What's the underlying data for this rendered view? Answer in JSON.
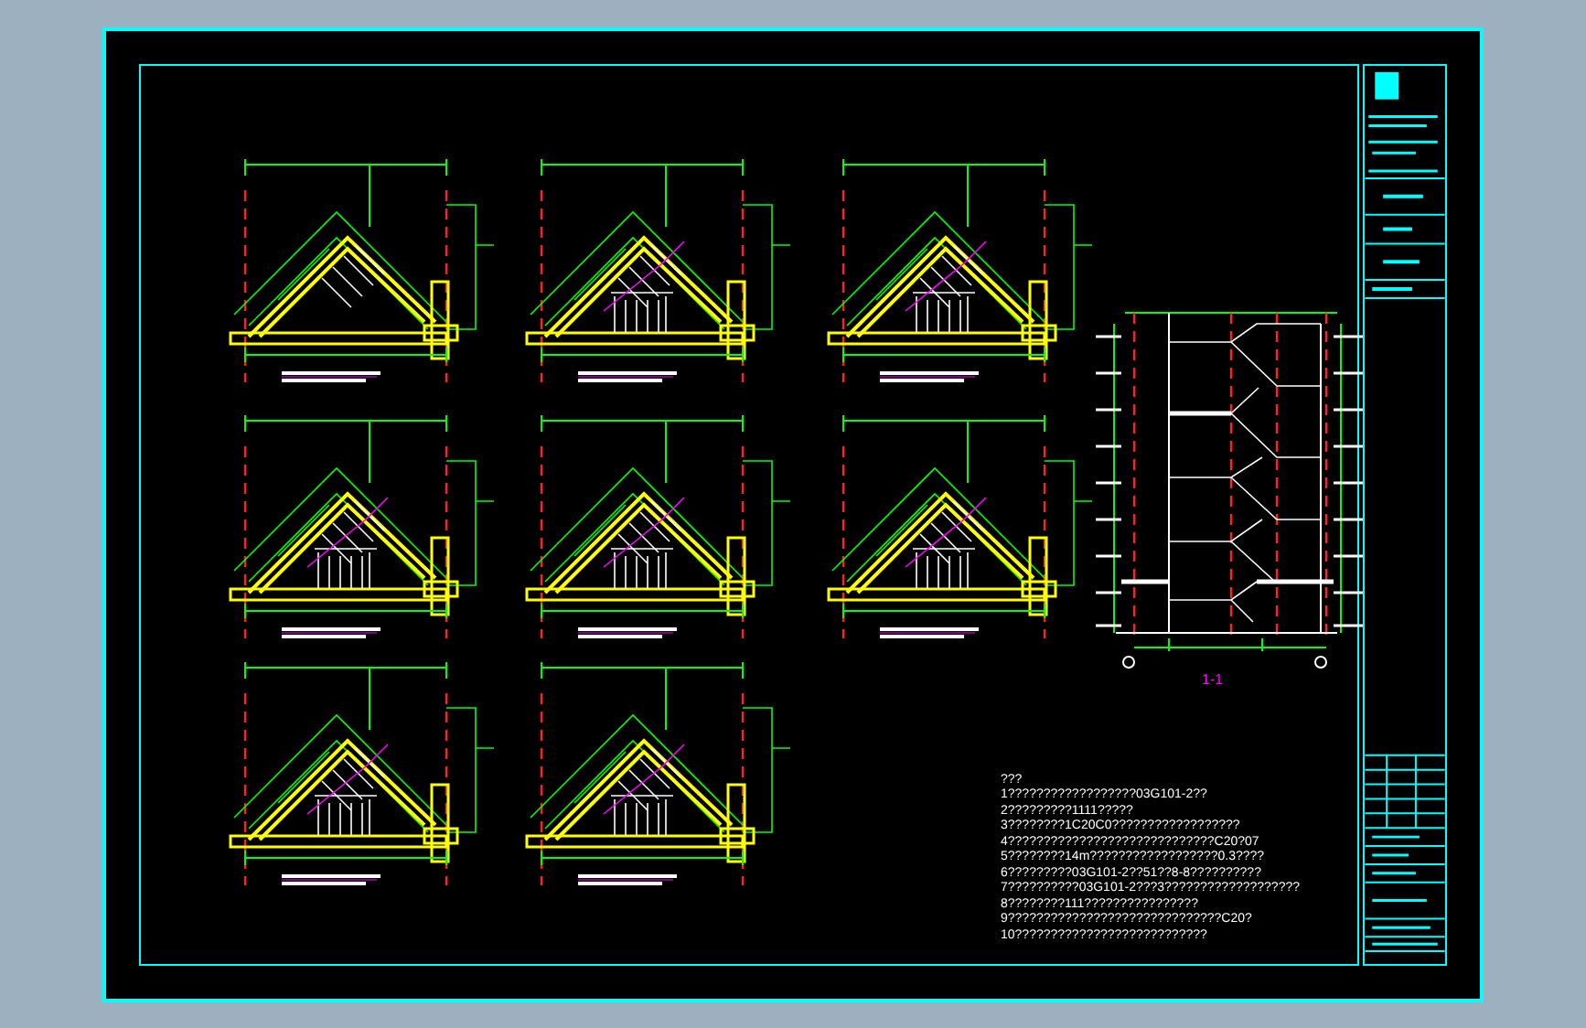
{
  "section": {
    "label": "1-1"
  },
  "notes": [
    "???",
    "1??????????????????03G101-2??",
    "2?????????1111?????",
    "3????????1C20C0??????????????????",
    "4?????????????????????????????C20?07",
    "5????????14m??????????????????0.3????",
    "6?????????03G101-2??51??8-8??????????",
    "7??????????03G101-2???3???????????????????",
    "8????????111????????????????",
    "9??????????????????????????????C20?",
    "10???????????????????????????"
  ]
}
